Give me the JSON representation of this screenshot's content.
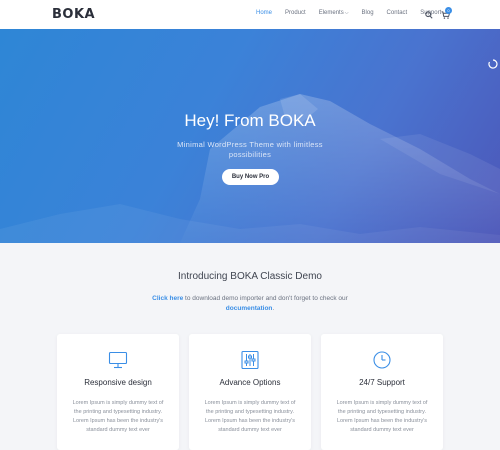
{
  "header": {
    "logo": "BOKA",
    "nav": [
      {
        "label": "Home",
        "active": true
      },
      {
        "label": "Product"
      },
      {
        "label": "Elements",
        "has_dropdown": true
      },
      {
        "label": "Blog"
      },
      {
        "label": "Contact"
      },
      {
        "label": "Support"
      }
    ],
    "cart_count": "0",
    "accent_color": "#3a8ee6"
  },
  "hero": {
    "title": "Hey! From BOKA",
    "subtitle": "Minimal WordPress Theme with limitless possibilities",
    "button_label": "Buy Now Pro"
  },
  "intro": {
    "title": "Introducing BOKA Classic Demo",
    "link1": "Click here",
    "text1": " to download demo importer and don't forget to check our ",
    "link2": "documentation",
    "text2": "."
  },
  "cards": [
    {
      "icon": "monitor-icon",
      "title": "Responsive design",
      "text": "Lorem Ipsum is simply dummy text of the printing and typesetting industry. Lorem Ipsum has been the industry's standard dummy text ever"
    },
    {
      "icon": "sliders-icon",
      "title": "Advance Options",
      "text": "Lorem Ipsum is simply dummy text of the printing and typesetting industry. Lorem Ipsum has been the industry's standard dummy text ever"
    },
    {
      "icon": "clock-icon",
      "title": "24/7 Support",
      "text": "Lorem Ipsum is simply dummy text of the printing and typesetting industry. Lorem Ipsum has been the industry's standard dummy text ever"
    }
  ]
}
